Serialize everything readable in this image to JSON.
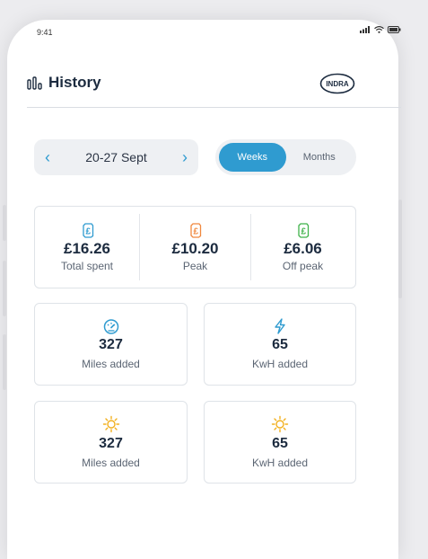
{
  "status_bar": {
    "time": "9:41"
  },
  "header": {
    "title": "History",
    "logo_text": "INDRA"
  },
  "date_range": {
    "label": "20-27 Sept"
  },
  "period_toggle": {
    "options": [
      "Weeks",
      "Months"
    ],
    "selected": "Weeks"
  },
  "summary": [
    {
      "value": "£16.26",
      "label": "Total spent",
      "icon": "pound-icon",
      "color": "#2f9bd0"
    },
    {
      "value": "£10.20",
      "label": "Peak",
      "icon": "pound-icon",
      "color": "#f0883e"
    },
    {
      "value": "£6.06",
      "label": "Off peak",
      "icon": "pound-icon",
      "color": "#3fb24a"
    }
  ],
  "tiles": [
    {
      "value": "327",
      "label": "Miles added",
      "icon": "speedometer-icon",
      "color": "#2f9bd0"
    },
    {
      "value": "65",
      "label": "KwH added",
      "icon": "lightning-icon",
      "color": "#2f9bd0"
    },
    {
      "value": "327",
      "label": "Miles added",
      "icon": "sun-icon",
      "color": "#f2b01e"
    },
    {
      "value": "65",
      "label": "KwH added",
      "icon": "sun-icon",
      "color": "#f2b01e"
    }
  ]
}
